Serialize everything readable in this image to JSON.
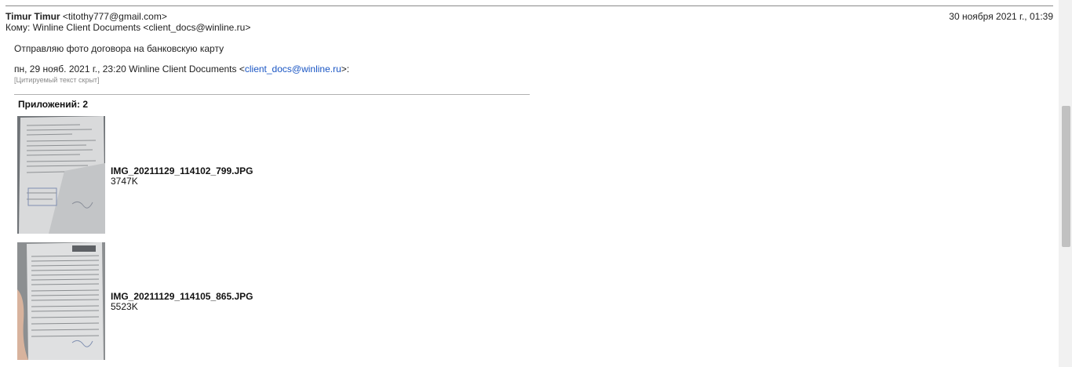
{
  "header": {
    "from_name": "Timur Timur",
    "from_email": "<titothy777@gmail.com>",
    "to_line": "Кому: Winline Client Documents <client_docs@winline.ru>",
    "date": "30 ноября 2021 г., 01:39"
  },
  "message": {
    "body": "Отправляю фото договора на банковскую карту",
    "quote_prefix": "пн, 29 нояб. 2021 г., 23:20 Winline Client Documents <",
    "quote_email": "client_docs@winline.ru",
    "quote_suffix": ">:",
    "hidden_quote": "[Цитируемый текст скрыт]"
  },
  "attachments": {
    "count_label": "Приложений: 2",
    "items": [
      {
        "name": "IMG_20211129_114102_799.JPG",
        "size": "3747K"
      },
      {
        "name": "IMG_20211129_114105_865.JPG",
        "size": "5523K"
      }
    ]
  }
}
